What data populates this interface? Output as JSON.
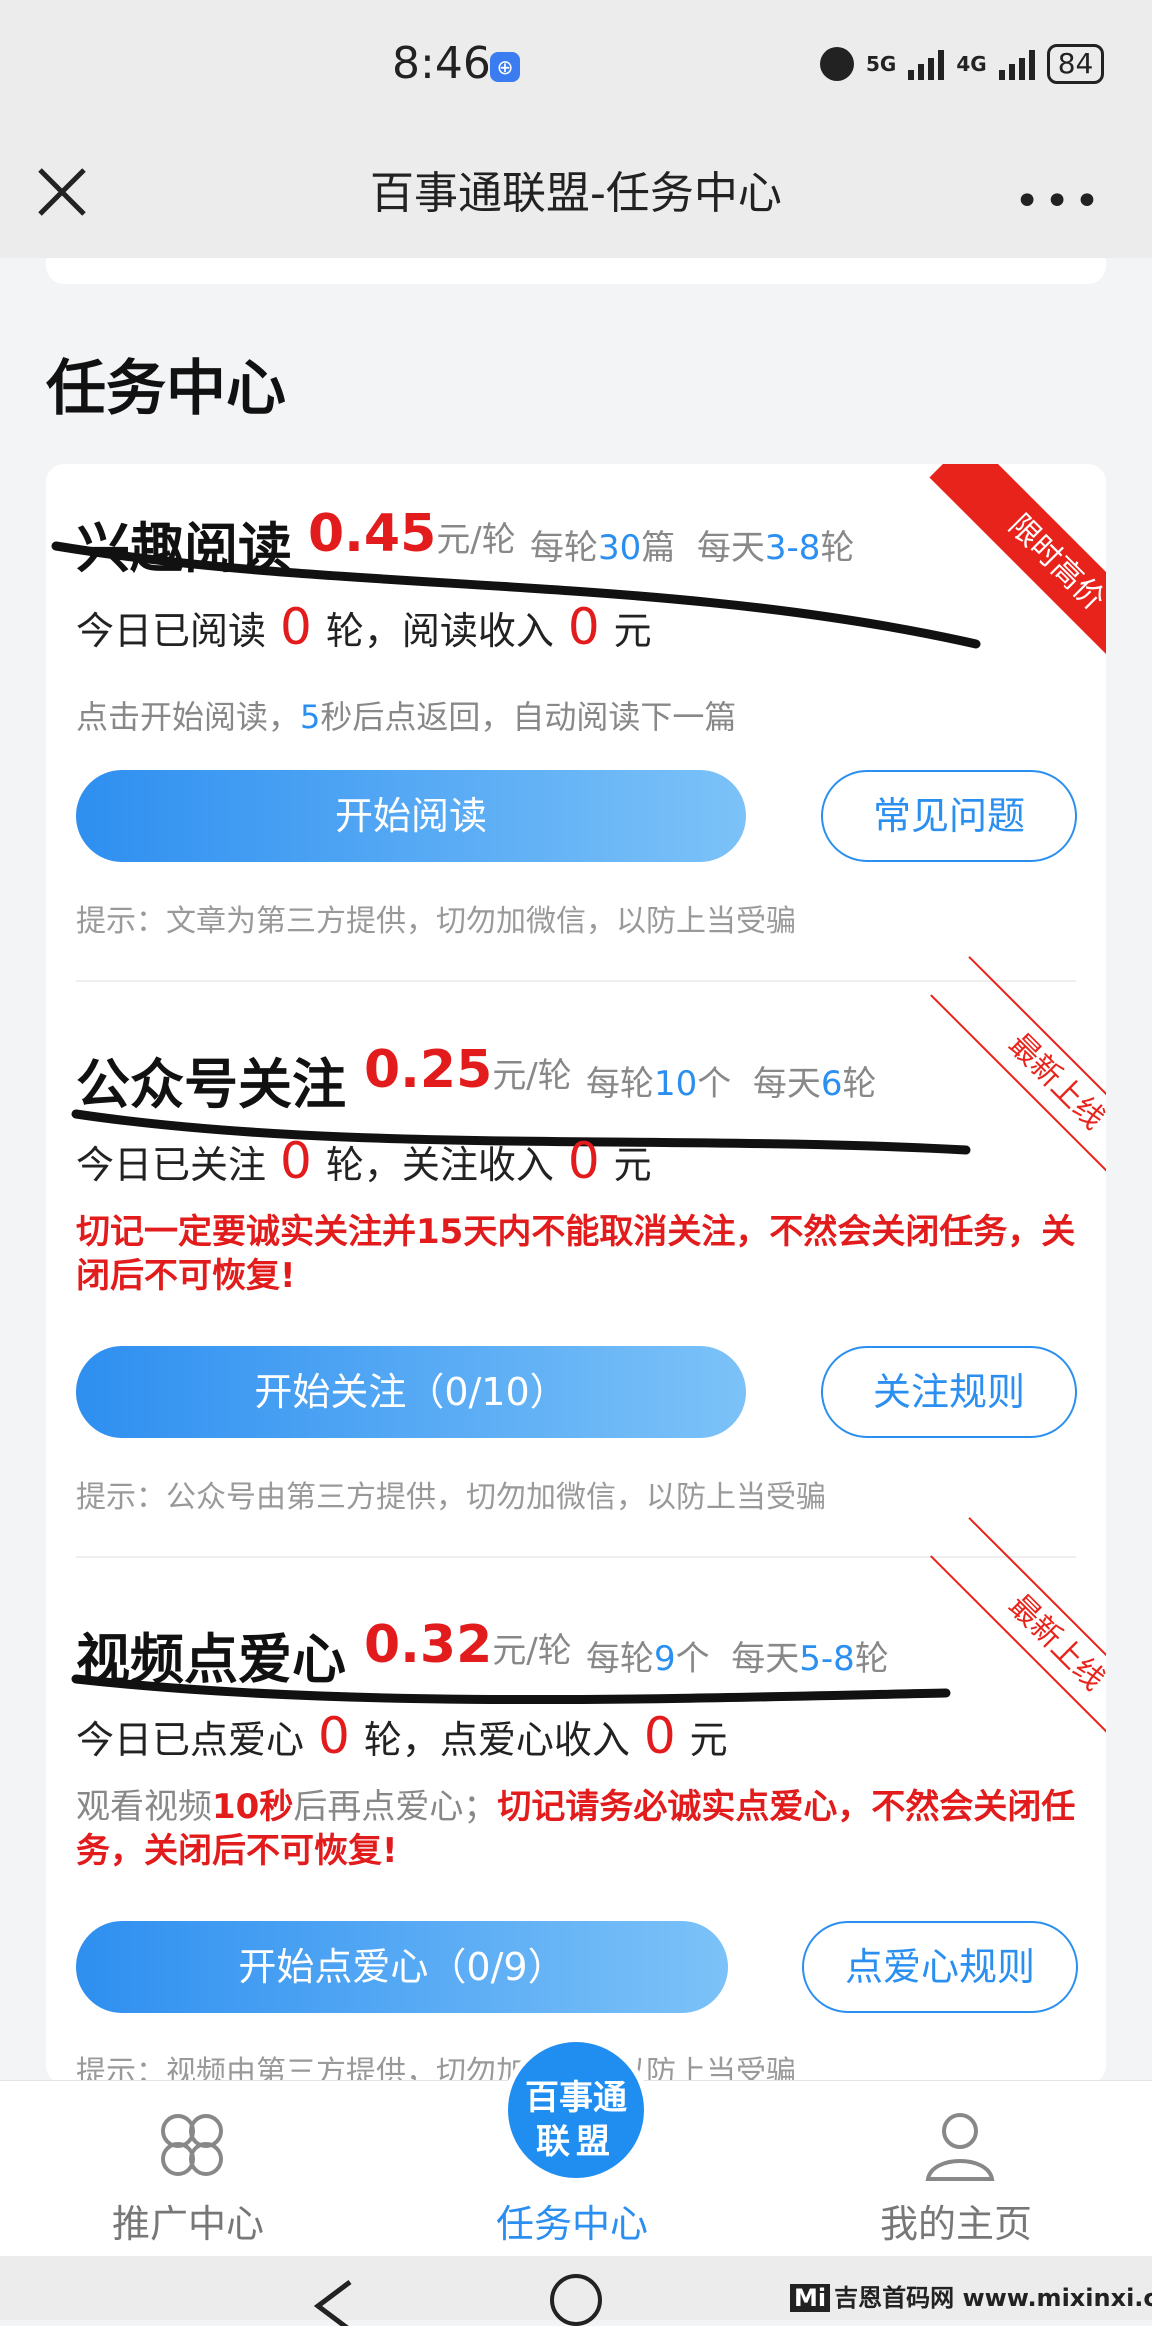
{
  "status_bar": {
    "time": "8:46",
    "net1": "5G",
    "net2": "4G",
    "battery": "84"
  },
  "nav": {
    "title": "百事通联盟-任务中心"
  },
  "section_title": "任务中心",
  "tasks": [
    {
      "title": "兴趣阅读",
      "price": "0.45",
      "unit": "元/轮",
      "meta1_pre": "每轮",
      "meta1_num": "30",
      "meta1_post": "篇",
      "meta2_pre": "每天",
      "meta2_num": "3-8",
      "meta2_post": "轮",
      "stats_pre": "今日已阅读",
      "stats_count": "0",
      "stats_mid": "轮，阅读收入",
      "stats_income": "0",
      "stats_post": "元",
      "desc_pre": "点击开始阅读，",
      "desc_num": "5",
      "desc_post": "秒后点返回，自动阅读下一篇",
      "primary_btn": "开始阅读",
      "secondary_btn": "常见问题",
      "tip": "提示：文章为第三方提供，切勿加微信，以防上当受骗",
      "ribbon": "限时高价"
    },
    {
      "title": "公众号关注",
      "price": "0.25",
      "unit": "元/轮",
      "meta1_pre": "每轮",
      "meta1_num": "10",
      "meta1_post": "个",
      "meta2_pre": "每天",
      "meta2_num": "6",
      "meta2_post": "轮",
      "stats_pre": "今日已关注",
      "stats_count": "0",
      "stats_mid": "轮，关注收入",
      "stats_income": "0",
      "stats_post": "元",
      "warning": "切记一定要诚实关注并15天内不能取消关注，不然会关闭任务，关闭后不可恢复!",
      "primary_btn": "开始关注（0/10）",
      "secondary_btn": "关注规则",
      "tip": "提示：公众号由第三方提供，切勿加微信，以防上当受骗",
      "ribbon": "最新上线"
    },
    {
      "title": "视频点爱心",
      "price": "0.32",
      "unit": "元/轮",
      "meta1_pre": "每轮",
      "meta1_num": "9",
      "meta1_post": "个",
      "meta2_pre": "每天",
      "meta2_num": "5-8",
      "meta2_post": "轮",
      "stats_pre": "今日已点爱心",
      "stats_count": "0",
      "stats_mid": "轮，点爱心收入",
      "stats_income": "0",
      "stats_post": "元",
      "desc_pre": "观看视频",
      "desc_num": "10秒",
      "desc_post": "后再点爱心；",
      "warning": "切记请务必诚实点爱心，不然会关闭任务，关闭后不可恢复!",
      "primary_btn": "开始点爱心（0/9）",
      "secondary_btn": "点爱心规则",
      "tip": "提示：视频由第三方提供，切勿加微信，以防上当受骗",
      "ribbon": "最新上线"
    }
  ],
  "tabbar": {
    "tab1": "推广中心",
    "tab2": "任务中心",
    "tab3": "我的主页",
    "badge_line1": "百事通",
    "badge_line2": "联盟"
  },
  "watermark": {
    "brand": "Mi",
    "text": "吉恩首码网 www.mixinxi.com"
  },
  "colors": {
    "accent": "#2a8ff0",
    "price": "#e21c1c",
    "ribbon": "#e8231b"
  }
}
